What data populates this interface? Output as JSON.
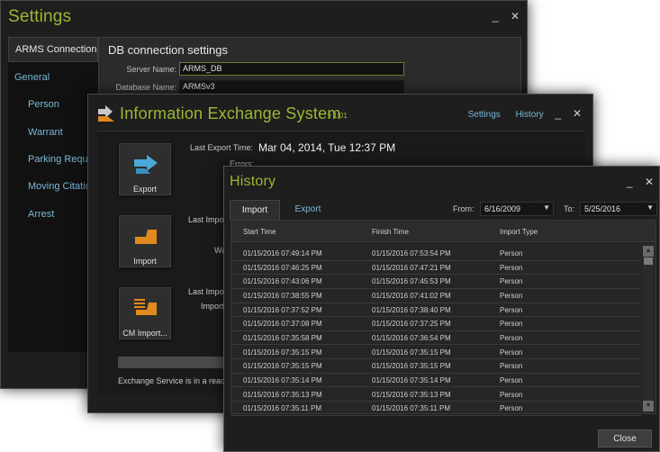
{
  "settings": {
    "title": "Settings",
    "controls": {
      "minimize": "_",
      "close": "✕"
    },
    "nav": {
      "active": "ARMS Connection",
      "items": [
        "General",
        "Person",
        "Warrant",
        "Parking Reques",
        "Moving Citation",
        "Arrest"
      ]
    },
    "section_title": "DB connection settings",
    "server_name_label": "Server Name:",
    "server_name_value": "ARMS_DB",
    "database_name_label": "Database Name:",
    "database_name_value": "ARMSv3"
  },
  "ies": {
    "title": "Information Exchange System",
    "version": "v 1.01",
    "links": {
      "settings": "Settings",
      "history": "History"
    },
    "controls": {
      "minimize": "_",
      "close": "✕"
    },
    "tiles": {
      "export": "Export",
      "import": "Import",
      "cm_import": "CM Import..."
    },
    "last_export_label": "Last Export Time:",
    "last_export_value": "Mar 04, 2014, Tue   12:37 PM",
    "errors_label": "Errors:",
    "last_import_label_1": "Last Impo",
    "wa_label": "Wa",
    "last_import_label_2": "Last Impo",
    "import_label": "Import",
    "status": "Exchange Service is in a read"
  },
  "history": {
    "title": "History",
    "controls": {
      "minimize": "_",
      "close": "✕"
    },
    "tabs": {
      "import": "Import",
      "export": "Export"
    },
    "from_label": "From:",
    "from_value": "6/16/2009",
    "to_label": "To:",
    "to_value": "5/25/2016",
    "columns": {
      "start": "Start Time",
      "finish": "Finish Time",
      "type": "Import Type"
    },
    "rows": [
      [
        "01/15/2016 07:49:14 PM",
        "01/15/2016 07:53:54 PM",
        "Person"
      ],
      [
        "01/15/2016 07:46:25 PM",
        "01/15/2016 07:47:21 PM",
        "Person"
      ],
      [
        "01/15/2016 07:43:06 PM",
        "01/15/2016 07:45:53 PM",
        "Person"
      ],
      [
        "01/15/2016 07:38:55 PM",
        "01/15/2016 07:41:02 PM",
        "Person"
      ],
      [
        "01/15/2016 07:37:52 PM",
        "01/15/2016 07:38:40 PM",
        "Person"
      ],
      [
        "01/15/2016 07:37:08 PM",
        "01/15/2016 07:37:25 PM",
        "Person"
      ],
      [
        "01/15/2016 07:35:58 PM",
        "01/15/2016 07:36:54 PM",
        "Person"
      ],
      [
        "01/15/2016 07:35:15 PM",
        "01/15/2016 07:35:15 PM",
        "Person"
      ],
      [
        "01/15/2016 07:35:15 PM",
        "01/15/2016 07:35:15 PM",
        "Person"
      ],
      [
        "01/15/2016 07:35:14 PM",
        "01/15/2016 07:35:14 PM",
        "Person"
      ],
      [
        "01/15/2016 07:35:13 PM",
        "01/15/2016 07:35:13 PM",
        "Person"
      ],
      [
        "01/15/2016 07:35:11 PM",
        "01/15/2016 07:35:11 PM",
        "Person"
      ]
    ],
    "close_label": "Close"
  }
}
